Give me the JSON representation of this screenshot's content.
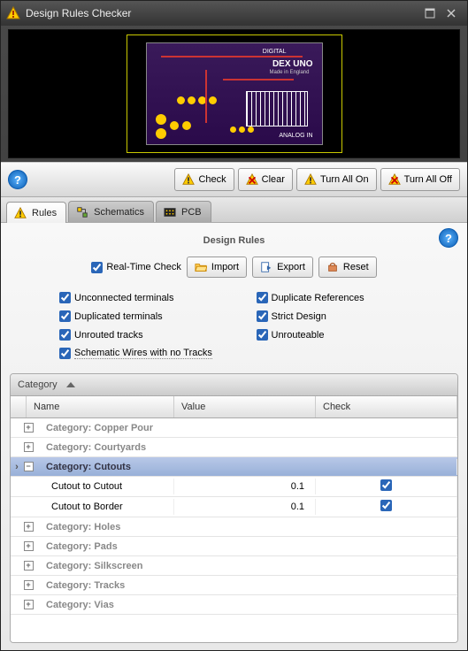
{
  "window": {
    "title": "Design Rules Checker"
  },
  "pcb": {
    "digital": "DIGITAL",
    "name": "DEX UNO",
    "made": "Made in England",
    "analog": "ANALOG IN"
  },
  "toolbar": {
    "check": "Check",
    "clear": "Clear",
    "turn_on": "Turn All On",
    "turn_off": "Turn All Off"
  },
  "tabs": {
    "rules": "Rules",
    "schematics": "Schematics",
    "pcb": "PCB"
  },
  "section": {
    "title": "Design Rules",
    "realtime": "Real-Time Check",
    "import": "Import",
    "export": "Export",
    "reset": "Reset"
  },
  "checks": {
    "unconnected": "Unconnected terminals",
    "duplicate_ref": "Duplicate References",
    "duplicated": "Duplicated terminals",
    "strict": "Strict Design",
    "unrouted": "Unrouted tracks",
    "unrouteable": "Unrouteable",
    "schem_wires": "Schematic Wires with no Tracks"
  },
  "grid": {
    "group_by": "Category",
    "headers": {
      "name": "Name",
      "value": "Value",
      "check": "Check"
    },
    "categories": [
      {
        "label": "Category: Copper Pour",
        "expanded": false
      },
      {
        "label": "Category: Courtyards",
        "expanded": false
      },
      {
        "label": "Category: Cutouts",
        "expanded": true,
        "rows": [
          {
            "name": "Cutout to Cutout",
            "value": "0.1",
            "checked": true
          },
          {
            "name": "Cutout to Border",
            "value": "0.1",
            "checked": true
          }
        ]
      },
      {
        "label": "Category: Holes",
        "expanded": false
      },
      {
        "label": "Category: Pads",
        "expanded": false
      },
      {
        "label": "Category: Silkscreen",
        "expanded": false
      },
      {
        "label": "Category: Tracks",
        "expanded": false
      },
      {
        "label": "Category: Vias",
        "expanded": false
      }
    ]
  }
}
